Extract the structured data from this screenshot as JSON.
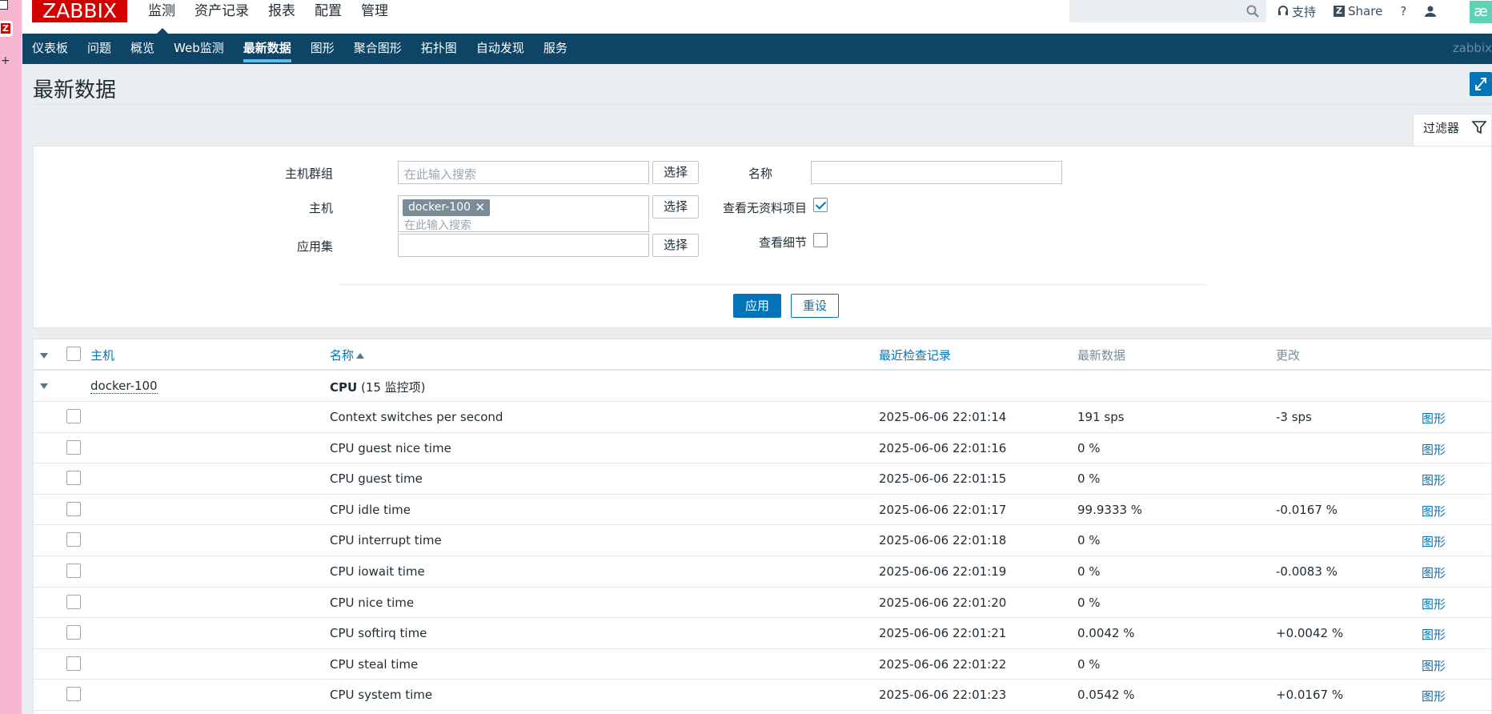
{
  "logo": "ZABBIX",
  "main_menu": [
    "监测",
    "资产记录",
    "报表",
    "配置",
    "管理"
  ],
  "tools": {
    "support": "支持",
    "share": "Share",
    "help": "?"
  },
  "sub_menu": [
    "仪表板",
    "问题",
    "概览",
    "Web监测",
    "最新数据",
    "图形",
    "聚合图形",
    "拓扑图",
    "自动发现",
    "服务"
  ],
  "brand": "zabbix",
  "page_title": "最新数据",
  "filter": {
    "tab_label": "过滤器",
    "hostgroup_label": "主机群组",
    "hostgroup_placeholder": "在此输入搜索",
    "host_label": "主机",
    "host_tag": "docker-100",
    "host_placeholder": "在此输入搜索",
    "app_label": "应用集",
    "select_label": "选择",
    "name_label": "名称",
    "show_without_data_label": "查看无资料项目",
    "show_without_data": true,
    "show_details_label": "查看细节",
    "show_details": false,
    "apply": "应用",
    "reset": "重设"
  },
  "table": {
    "headers": {
      "host": "主机",
      "name": "名称",
      "last_check": "最近检查记录",
      "last_value": "最新数据",
      "change": "更改"
    },
    "group": {
      "host": "docker-100",
      "app": "CPU",
      "count": "(15 监控项)"
    },
    "rows": [
      {
        "name": "Context switches per second",
        "time": "2025-06-06 22:01:14",
        "value": "191 sps",
        "change": "-3 sps",
        "graph": "图形"
      },
      {
        "name": "CPU guest nice time",
        "time": "2025-06-06 22:01:16",
        "value": "0 %",
        "change": "",
        "graph": "图形"
      },
      {
        "name": "CPU guest time",
        "time": "2025-06-06 22:01:15",
        "value": "0 %",
        "change": "",
        "graph": "图形"
      },
      {
        "name": "CPU idle time",
        "time": "2025-06-06 22:01:17",
        "value": "99.9333 %",
        "change": "-0.0167 %",
        "graph": "图形"
      },
      {
        "name": "CPU interrupt time",
        "time": "2025-06-06 22:01:18",
        "value": "0 %",
        "change": "",
        "graph": "图形"
      },
      {
        "name": "CPU iowait time",
        "time": "2025-06-06 22:01:19",
        "value": "0 %",
        "change": "-0.0083 %",
        "graph": "图形"
      },
      {
        "name": "CPU nice time",
        "time": "2025-06-06 22:01:20",
        "value": "0 %",
        "change": "",
        "graph": "图形"
      },
      {
        "name": "CPU softirq time",
        "time": "2025-06-06 22:01:21",
        "value": "0.0042 %",
        "change": "+0.0042 %",
        "graph": "图形"
      },
      {
        "name": "CPU steal time",
        "time": "2025-06-06 22:01:22",
        "value": "0 %",
        "change": "",
        "graph": "图形"
      },
      {
        "name": "CPU system time",
        "time": "2025-06-06 22:01:23",
        "value": "0.0542 %",
        "change": "+0.0167 %",
        "graph": "图形"
      }
    ]
  }
}
